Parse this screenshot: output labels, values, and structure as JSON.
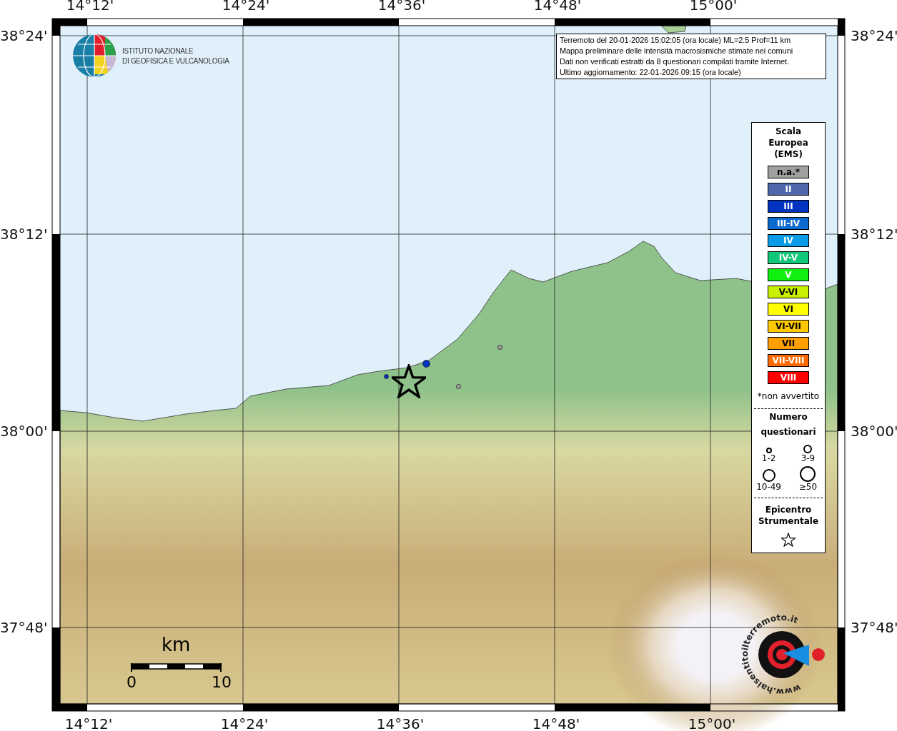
{
  "map": {
    "lon_labels_top": [
      "14°12'",
      "14°24'",
      "14°36'",
      "14°48'",
      "15°00'"
    ],
    "lon_labels_bottom": [
      "14°12'",
      "14°24'",
      "14°36'",
      "14°48'",
      "15°00'"
    ],
    "lat_labels_left": [
      "38°24'",
      "38°12'",
      "38°00'",
      "37°48'"
    ],
    "lat_labels_right": [
      "38°24'",
      "38°12'",
      "38°00'",
      "37°48'"
    ]
  },
  "logo": {
    "lines": [
      "ISTITUTO NAZIONALE",
      "DI GEOFISICA E VULCANOLOGIA"
    ]
  },
  "info_box": {
    "lines": [
      "Terremoto del 20-01-2026 15:02:05 (ora locale) ML=2.5 Prof=11 km",
      "Mappa preliminare delle intensità macrosismiche stimate nei comuni",
      "Dati non verificati estratti da 8 questionari compilati tramite Internet.",
      "Ultimo aggiornamento: 22-01-2026 09:15 (ora locale)"
    ]
  },
  "observations": [
    {
      "color": "#0033c0",
      "kind": "medium"
    },
    {
      "color": "#0033c0",
      "kind": "small"
    },
    {
      "color": "#a0a0a0",
      "kind": "small"
    },
    {
      "color": "#a0a0a0",
      "kind": "small"
    }
  ],
  "legend": {
    "title_lines": [
      "Scala",
      "Europea",
      "(EMS)"
    ],
    "levels": [
      {
        "label": "n.a.*",
        "color": "#a0a0a0"
      },
      {
        "label": "II",
        "color": "#4e68ab"
      },
      {
        "label": "III",
        "color": "#0033c0"
      },
      {
        "label": "III-IV",
        "color": "#0a6ad0"
      },
      {
        "label": "IV",
        "color": "#0a9be6"
      },
      {
        "label": "IV-V",
        "color": "#10c878"
      },
      {
        "label": "V",
        "color": "#10f010"
      },
      {
        "label": "V-VI",
        "color": "#c8f000"
      },
      {
        "label": "VI",
        "color": "#ffff00"
      },
      {
        "label": "VI-VII",
        "color": "#ffc800"
      },
      {
        "label": "VII",
        "color": "#ffa000"
      },
      {
        "label": "VII-VIII",
        "color": "#ff6a00"
      },
      {
        "label": "VIII",
        "color": "#ff0000"
      }
    ],
    "note": "*non avvertito",
    "count_title_lines": [
      "Numero",
      "questionari"
    ],
    "count_sizes": [
      {
        "label": "1-2",
        "kind": "xs"
      },
      {
        "label": "3-9",
        "kind": "s"
      },
      {
        "label": "10-49",
        "kind": "m"
      },
      {
        "label": "≥50",
        "kind": "l"
      }
    ],
    "epicenter_title_lines": [
      "Epicentro",
      "Strumentale"
    ]
  },
  "scale_bar": {
    "unit": "km",
    "min": "0",
    "max": "10"
  },
  "site_logo": {
    "text": "www.haisentitoilterremoto.it"
  }
}
